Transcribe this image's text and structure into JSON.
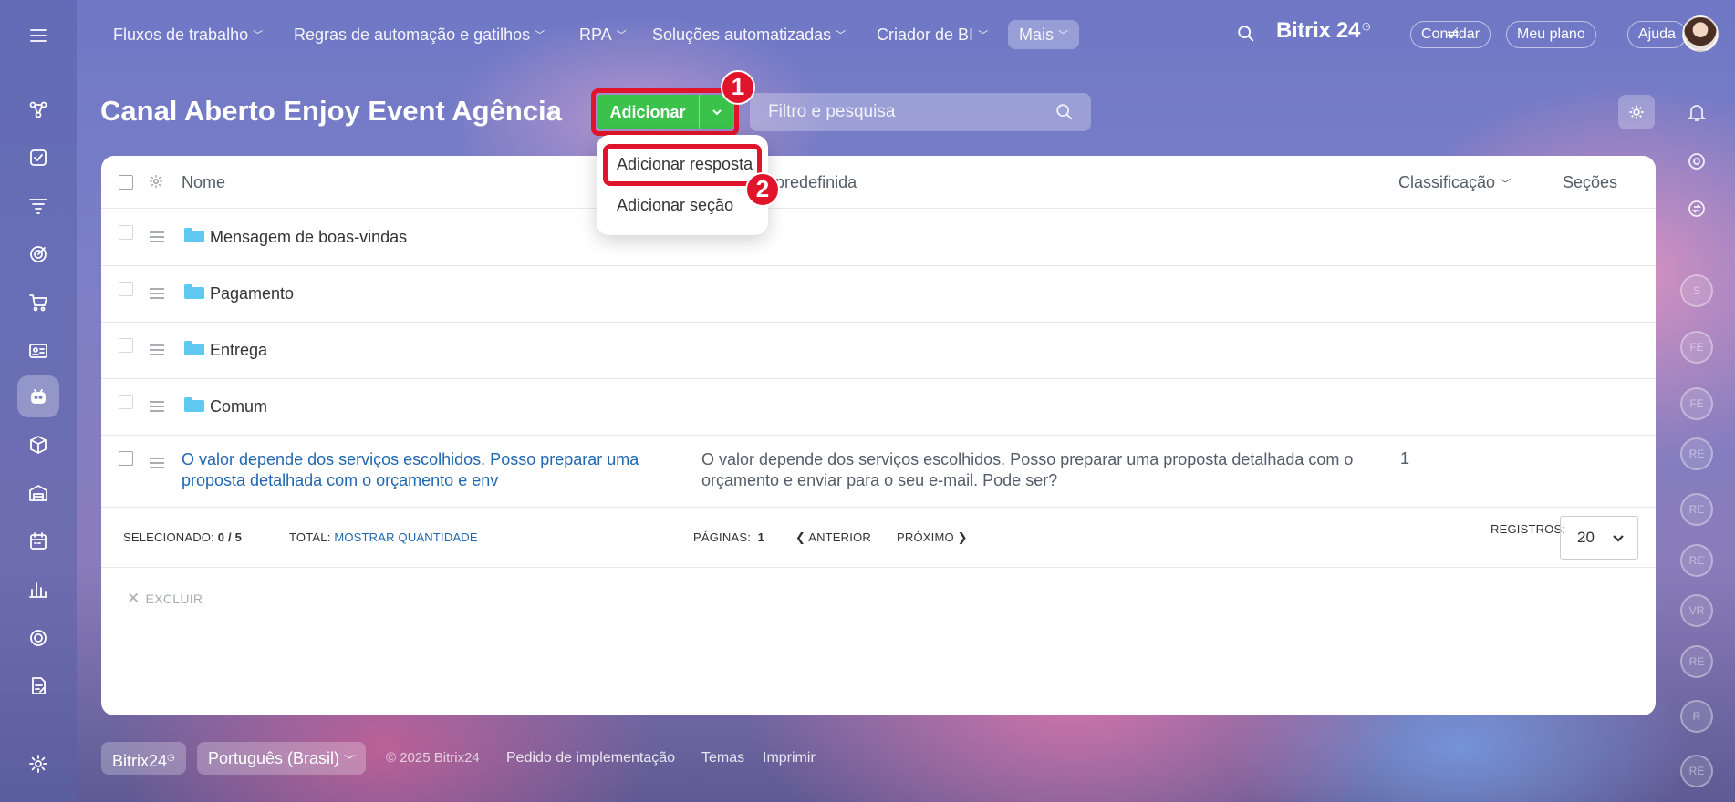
{
  "nav": {
    "items": [
      {
        "label": "Fluxos de trabalho"
      },
      {
        "label": "Regras de automação e gatilhos"
      },
      {
        "label": "RPA"
      },
      {
        "label": "Soluções automatizadas"
      },
      {
        "label": "Criador de BI"
      },
      {
        "label": "Mais"
      }
    ],
    "brand": "Bitrix 24",
    "invite": "Convidar",
    "plan": "Meu plano",
    "help": "Ajuda"
  },
  "page": {
    "title": "Canal Aberto Enjoy Event Agência",
    "add_button": "Adicionar",
    "search_placeholder": "Filtro e pesquisa"
  },
  "annotations": {
    "step1": "1",
    "step2": "2"
  },
  "dropdown": {
    "items": [
      "Adicionar resposta",
      "Adicionar seção"
    ]
  },
  "table": {
    "headers": {
      "name": "Nome",
      "answer": "Resposta predefinida",
      "sort": "Classificação",
      "sections": "Seções"
    },
    "folders": [
      "Mensagem de boas-vindas",
      "Pagamento",
      "Entrega",
      "Comum"
    ],
    "row": {
      "name_line1": "O valor depende dos serviços escolhidos. Posso preparar uma",
      "name_line2": "proposta detalhada com o orçamento e env",
      "answer_line1": "O valor depende dos serviços escolhidos. Posso preparar uma proposta detalhada com o",
      "answer_line2": "orçamento e enviar para o seu e-mail. Pode ser?",
      "sort": "1"
    }
  },
  "footer": {
    "selected_label": "SELECIONADO:",
    "selected_value": "0 / 5",
    "total_label": "TOTAL:",
    "total_link": "MOSTRAR QUANTIDADE",
    "pages_label": "PÁGINAS:",
    "pages_value": "1",
    "prev": "ANTERIOR",
    "next": "PRÓXIMO",
    "records_label": "REGISTROS:",
    "records_value": "20",
    "delete": "EXCLUIR"
  },
  "bottom": {
    "brand": "Bitrix24",
    "language": "Português (Brasil)",
    "copyright": "© 2025 Bitrix24",
    "implementation": "Pedido de implementação",
    "themes": "Temas",
    "print": "Imprimir"
  },
  "right_avatars": [
    "S",
    "FE",
    "FE",
    "RE",
    "RE",
    "RE",
    "VR",
    "RE",
    "R",
    "RE"
  ],
  "colors": {
    "accent_green": "#3bc24a",
    "annotation_red": "#e0142a",
    "link_blue": "#2067b0",
    "folder_blue": "#5fc8f0"
  }
}
